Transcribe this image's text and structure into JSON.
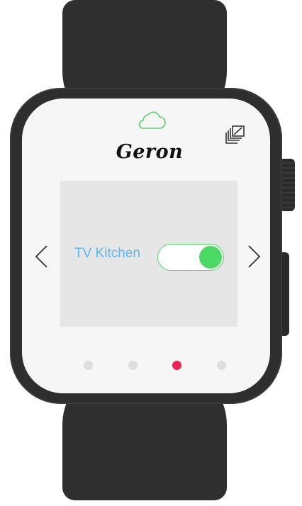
{
  "app": {
    "title": "Geron"
  },
  "device": {
    "name": "TV Kitchen",
    "switch_on": true
  },
  "pager": {
    "count": 4,
    "active_index": 2
  },
  "icons": {
    "top_center": "cloud-icon",
    "top_right": "multi-window-icon",
    "left_nav": "chevron-left-icon",
    "right_nav": "chevron-right-icon"
  },
  "colors": {
    "accent_green": "#4cd964",
    "cloud_green": "#5ccf6d",
    "label_blue": "#5bb8ea",
    "active_dot": "#ee2452",
    "inactive_dot": "#dddddd",
    "watch_body": "#2e2e2e",
    "screen_bg": "#f6f6f6",
    "card_bg": "#e6e6e6"
  }
}
